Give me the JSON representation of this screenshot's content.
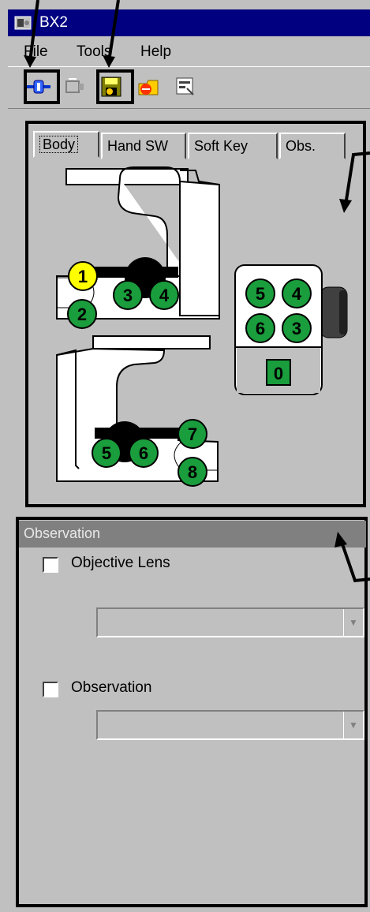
{
  "window": {
    "title": "BX2"
  },
  "menu": {
    "items": [
      "File",
      "Tools",
      "Help"
    ]
  },
  "toolbar": {
    "buttons": [
      {
        "icon": "connect-icon",
        "highlighted": true
      },
      {
        "icon": "disconnect-icon",
        "highlighted": false
      },
      {
        "icon": "save-icon",
        "highlighted": true
      },
      {
        "icon": "load-icon",
        "highlighted": false
      },
      {
        "icon": "settings-icon",
        "highlighted": false
      }
    ]
  },
  "tabs": [
    "Body",
    "Hand SW",
    "Soft Key",
    "Obs."
  ],
  "active_tab": "Body",
  "body_buttons": {
    "upper": [
      "1",
      "2",
      "3",
      "4"
    ],
    "lower": [
      "5",
      "6",
      "7",
      "8"
    ],
    "handset": [
      "5",
      "4",
      "6",
      "3",
      "0"
    ]
  },
  "observation_panel": {
    "title": "Observation",
    "fields": [
      {
        "label": "Objective Lens",
        "checked": false,
        "value": ""
      },
      {
        "label": "Observation",
        "checked": false,
        "value": ""
      }
    ]
  },
  "colors": {
    "green_button": "#1a9d3c",
    "yellow_button": "#ffff00",
    "titlebar": "#000080",
    "window": "#c0c0c0"
  }
}
